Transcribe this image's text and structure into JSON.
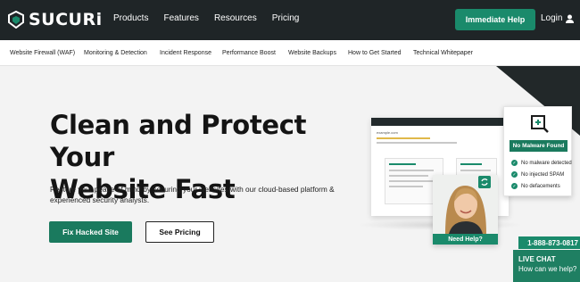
{
  "brand": {
    "name": "SUCURi",
    "accent": "#1a8a6b",
    "dark": "#1f2527"
  },
  "nav": {
    "items": [
      "Products",
      "Features",
      "Resources",
      "Pricing"
    ],
    "cta": "Immediate Help",
    "login": "Login"
  },
  "subnav": {
    "items": [
      "Website Firewall (WAF)",
      "Monitoring & Detection",
      "Incident Response",
      "Performance Boost",
      "Website Backups",
      "How to Get Started",
      "Technical Whitepaper"
    ]
  },
  "hero": {
    "title_line1": "Clean and Protect Your",
    "title_line2": "Website Fast",
    "subtitle": "Restore your peace of mind by securing your websites with our cloud-based platform & experienced security analysts.",
    "primary_button": "Fix Hacked Site",
    "secondary_button": "See Pricing"
  },
  "mock": {
    "site": "example.com"
  },
  "malware_card": {
    "heading": "No Malware Found",
    "items": [
      "No malware detected",
      "No injected SPAM",
      "No defacements"
    ]
  },
  "person_card": {
    "label": "Need Help?"
  },
  "chat": {
    "phone": "1-888-873-0817",
    "title": "LIVE CHAT",
    "subtitle": "How can we help?"
  }
}
